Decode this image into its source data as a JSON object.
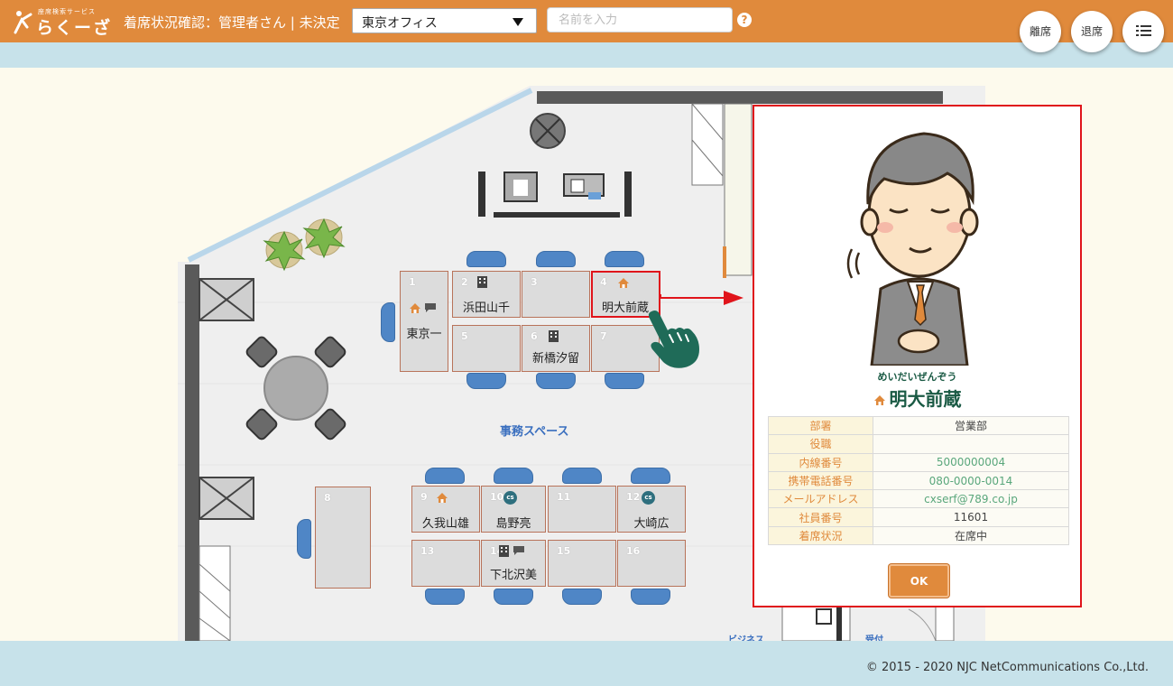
{
  "header": {
    "logo_small": "座席検索サービス",
    "logo_big": "らくーざ",
    "title": "着席状況確認：管理者さん | 未決定",
    "office_selected": "東京オフィス",
    "search_placeholder": "名前を入力",
    "help": "?",
    "btn_away": "離席",
    "btn_leave": "退席",
    "brand_color": "#e08a3c"
  },
  "floor": {
    "space_label": "事務スペース",
    "label_business": "ビジネス",
    "label_reception": "受付",
    "desks": [
      {
        "num": "1",
        "name": "東京一",
        "status": "home-chat"
      },
      {
        "num": "2",
        "name": "浜田山千",
        "status": "office"
      },
      {
        "num": "3",
        "name": "",
        "status": ""
      },
      {
        "num": "4",
        "name": "明大前蔵",
        "status": "home"
      },
      {
        "num": "5",
        "name": "",
        "status": ""
      },
      {
        "num": "6",
        "name": "新橋汐留",
        "status": "office"
      },
      {
        "num": "7",
        "name": "",
        "status": ""
      },
      {
        "num": "8",
        "name": "",
        "status": ""
      },
      {
        "num": "9",
        "name": "久我山雄",
        "status": "home"
      },
      {
        "num": "10",
        "name": "島野亮",
        "status": "cs"
      },
      {
        "num": "11",
        "name": "",
        "status": ""
      },
      {
        "num": "12",
        "name": "大崎広",
        "status": "cs"
      },
      {
        "num": "13",
        "name": "",
        "status": ""
      },
      {
        "num": "14",
        "name": "下北沢美",
        "status": "office-chat"
      },
      {
        "num": "15",
        "name": "",
        "status": ""
      },
      {
        "num": "16",
        "name": "",
        "status": ""
      }
    ],
    "cs_badge": "cs"
  },
  "profile": {
    "furigana": "めいだいぜんぞう",
    "name": "明大前蔵",
    "rows": [
      {
        "label": "部署",
        "value": "営業部"
      },
      {
        "label": "役職",
        "value": ""
      },
      {
        "label": "内線番号",
        "value": "5000000004"
      },
      {
        "label": "携帯電話番号",
        "value": "080-0000-0014"
      },
      {
        "label": "メールアドレス",
        "value": "cxserf@789.co.jp"
      },
      {
        "label": "社員番号",
        "value": "11601"
      },
      {
        "label": "着席状況",
        "value": "在席中"
      }
    ],
    "ok_label": "OK"
  },
  "footer": {
    "copyright": "© 2015 - 2020 NJC NetCommunications Co.,Ltd."
  }
}
